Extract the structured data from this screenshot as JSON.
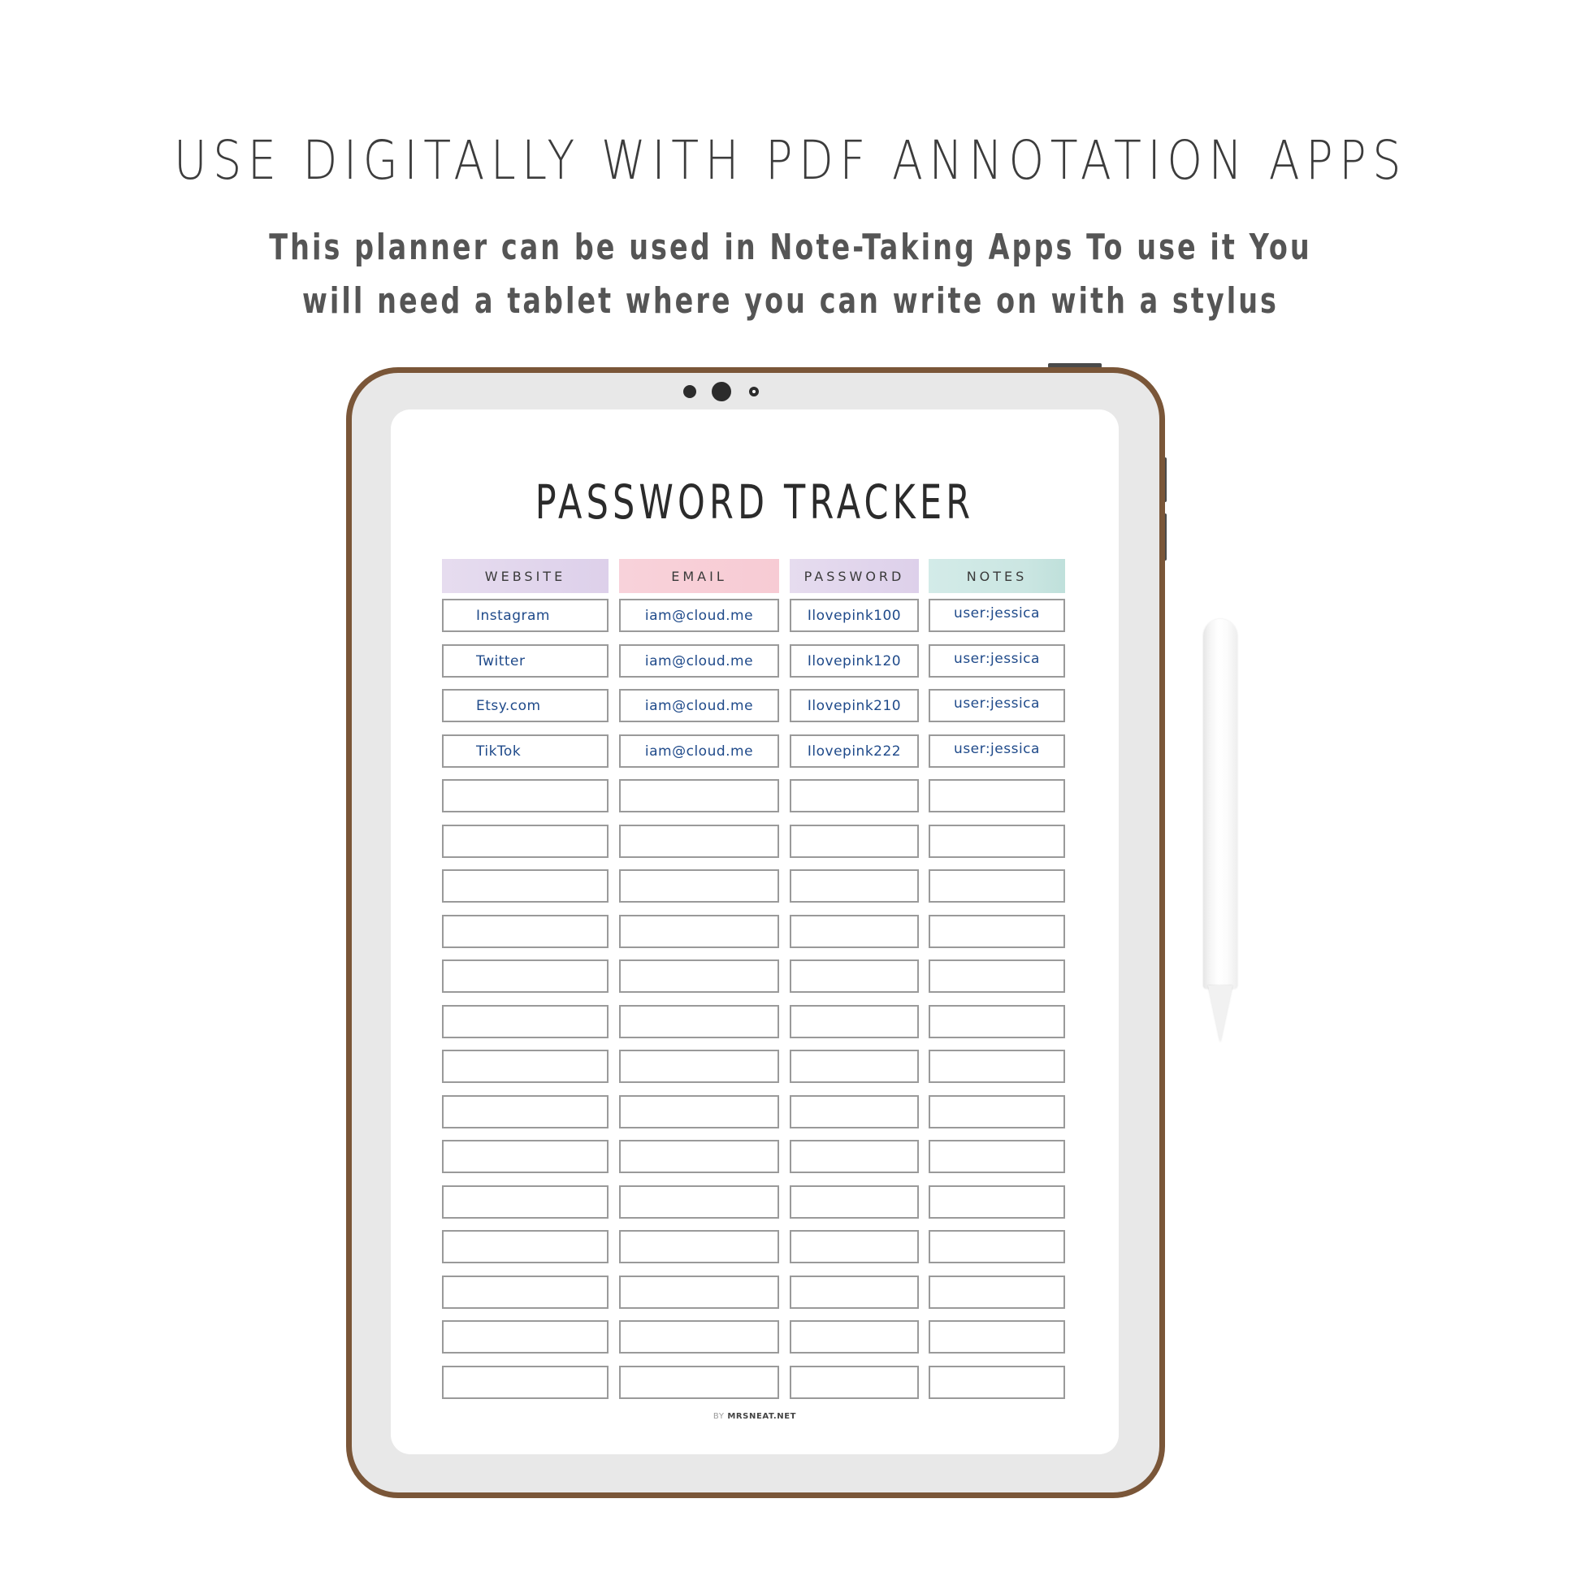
{
  "headline": "USE DIGITALLY WITH PDF ANNOTATION APPS",
  "subtitle": {
    "line1": "This planner can be used in Note-Taking Apps  To use it You",
    "line2": "will need a tablet where you can write on with a stylus"
  },
  "device": {
    "frame_color": "#7a5638",
    "bezel_color": "#e8e8e8",
    "camera_icons": [
      "camera-dot-icon",
      "camera-lens-icon",
      "sensor-ring-icon"
    ],
    "stylus_icon": "stylus-pencil-icon"
  },
  "document": {
    "title": "PASSWORD TRACKER",
    "columns": [
      {
        "key": "website",
        "label": "WEBSITE",
        "color": "#e2d6ec"
      },
      {
        "key": "email",
        "label": "EMAIL",
        "color": "#f8cfd8"
      },
      {
        "key": "password",
        "label": "PASSWORD",
        "color": "#e2d6ec"
      },
      {
        "key": "notes",
        "label": "NOTES",
        "color": "#cde8e4"
      }
    ],
    "rows": [
      {
        "website": "Instagram",
        "email": "iam@cloud.me",
        "password": "Ilovepink100",
        "notes": "user:jessica"
      },
      {
        "website": "Twitter",
        "email": "iam@cloud.me",
        "password": "Ilovepink120",
        "notes": "user:jessica"
      },
      {
        "website": "Etsy.com",
        "email": "iam@cloud.me",
        "password": "Ilovepink210",
        "notes": "user:jessica"
      },
      {
        "website": "TikTok",
        "email": "iam@cloud.me",
        "password": "Ilovepink222",
        "notes": "user:jessica"
      },
      {
        "website": "",
        "email": "",
        "password": "",
        "notes": ""
      },
      {
        "website": "",
        "email": "",
        "password": "",
        "notes": ""
      },
      {
        "website": "",
        "email": "",
        "password": "",
        "notes": ""
      },
      {
        "website": "",
        "email": "",
        "password": "",
        "notes": ""
      },
      {
        "website": "",
        "email": "",
        "password": "",
        "notes": ""
      },
      {
        "website": "",
        "email": "",
        "password": "",
        "notes": ""
      },
      {
        "website": "",
        "email": "",
        "password": "",
        "notes": ""
      },
      {
        "website": "",
        "email": "",
        "password": "",
        "notes": ""
      },
      {
        "website": "",
        "email": "",
        "password": "",
        "notes": ""
      },
      {
        "website": "",
        "email": "",
        "password": "",
        "notes": ""
      },
      {
        "website": "",
        "email": "",
        "password": "",
        "notes": ""
      },
      {
        "website": "",
        "email": "",
        "password": "",
        "notes": ""
      },
      {
        "website": "",
        "email": "",
        "password": "",
        "notes": ""
      },
      {
        "website": "",
        "email": "",
        "password": "",
        "notes": ""
      }
    ],
    "footer": {
      "by": "BY",
      "brand": "MRSNEAT.NET"
    },
    "handwriting_color": "#1f4a8a"
  }
}
